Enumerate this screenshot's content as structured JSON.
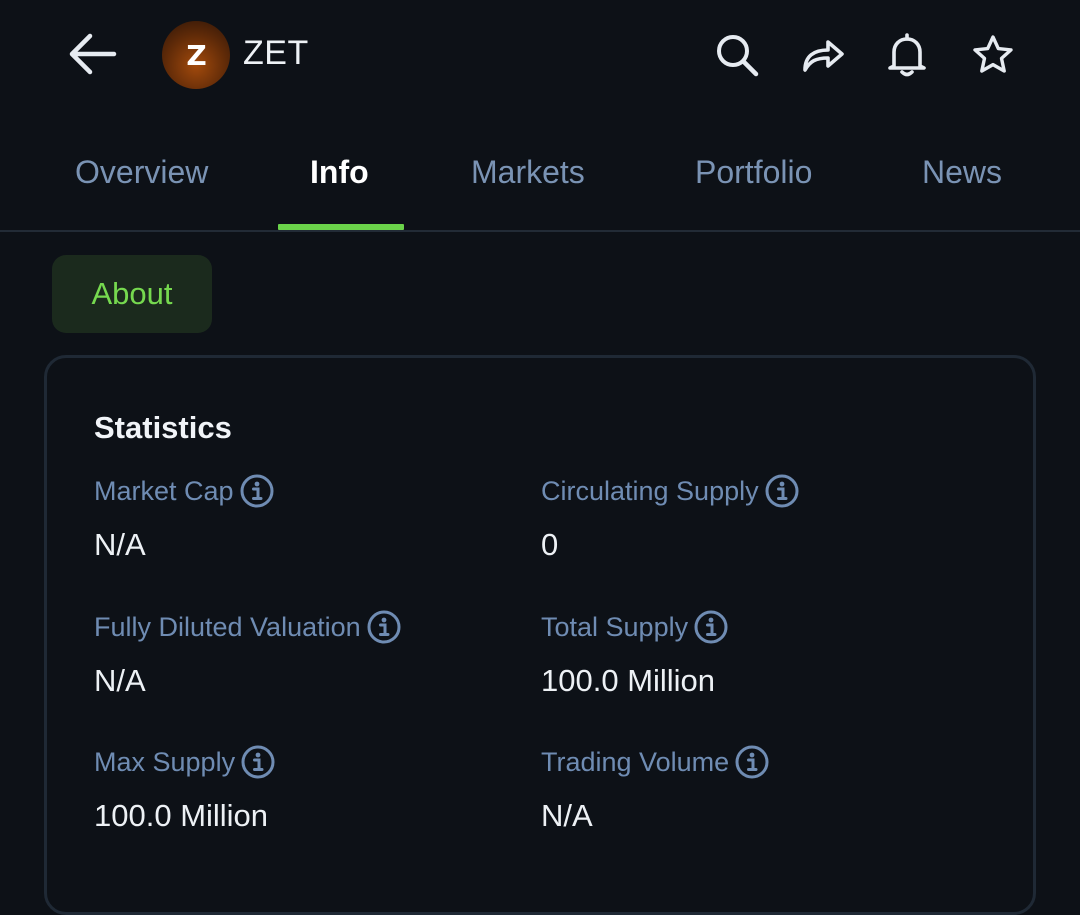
{
  "header": {
    "coin_logo_letter": "Z",
    "coin_symbol": "ZET",
    "icons": [
      "back-arrow-icon",
      "search-icon",
      "share-icon",
      "bell-icon",
      "star-icon"
    ]
  },
  "tabs": [
    {
      "label": "Overview",
      "active": false
    },
    {
      "label": "Info",
      "active": true
    },
    {
      "label": "Markets",
      "active": false
    },
    {
      "label": "Portfolio",
      "active": false
    },
    {
      "label": "News",
      "active": false
    }
  ],
  "chip": {
    "label": "About"
  },
  "statistics": {
    "title": "Statistics",
    "items": [
      {
        "label": "Market Cap",
        "value": "N/A"
      },
      {
        "label": "Circulating Supply",
        "value": "0"
      },
      {
        "label": "Fully Diluted Valuation",
        "value": "N/A"
      },
      {
        "label": "Total Supply",
        "value": "100.0 Million"
      },
      {
        "label": "Max Supply",
        "value": "100.0 Million"
      },
      {
        "label": "Trading Volume",
        "value": "N/A"
      }
    ]
  },
  "colors": {
    "background": "#0d1117",
    "accent_green": "#6ad34a",
    "tab_inactive": "#7a93b4",
    "label_blue": "#6f8cb3",
    "card_border": "#1f2935"
  }
}
